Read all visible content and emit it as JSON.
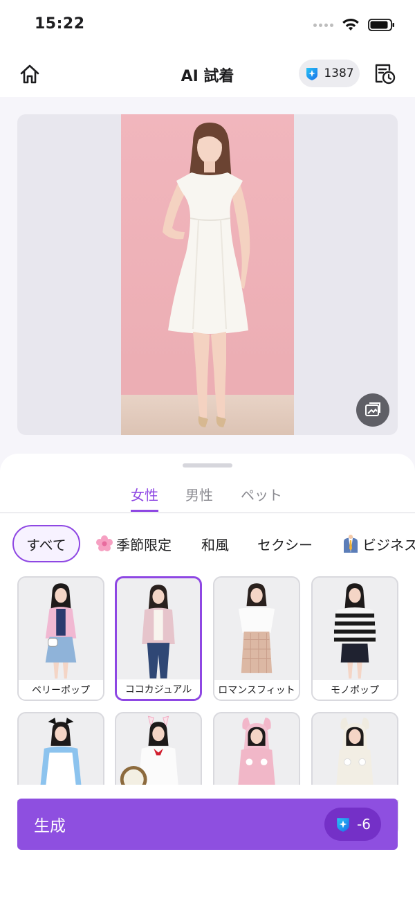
{
  "status_bar": {
    "time": "15:22"
  },
  "header": {
    "title": "AI 試着",
    "credits": "1387",
    "icons": {
      "home": "home-icon",
      "credits": "gem-icon",
      "history": "history-icon"
    }
  },
  "preview": {
    "swap_icon": "image-swap-icon"
  },
  "gender_tabs": [
    {
      "label": "女性",
      "active": true
    },
    {
      "label": "男性",
      "active": false
    },
    {
      "label": "ペット",
      "active": false
    }
  ],
  "style_tabs": [
    {
      "label": "すべて",
      "selected": true
    },
    {
      "label": "季節限定",
      "emoji": "🌸"
    },
    {
      "label": "和風"
    },
    {
      "label": "セクシー"
    },
    {
      "label": "ビジネス",
      "emoji": "👔"
    }
  ],
  "outfits": [
    {
      "label": "ベリーポップ",
      "selected": false
    },
    {
      "label": "ココカジュアル",
      "selected": true
    },
    {
      "label": "ロマンスフィット",
      "selected": false
    },
    {
      "label": "モノポップ",
      "selected": false
    },
    {
      "label": "",
      "selected": false
    },
    {
      "label": "",
      "selected": false
    },
    {
      "label": "",
      "selected": false
    },
    {
      "label": "",
      "selected": false
    }
  ],
  "generate": {
    "label": "生成",
    "cost": "-6"
  },
  "colors": {
    "accent": "#8e47e3",
    "button": "#8e4fe0",
    "cost_pill": "#7430c7"
  }
}
